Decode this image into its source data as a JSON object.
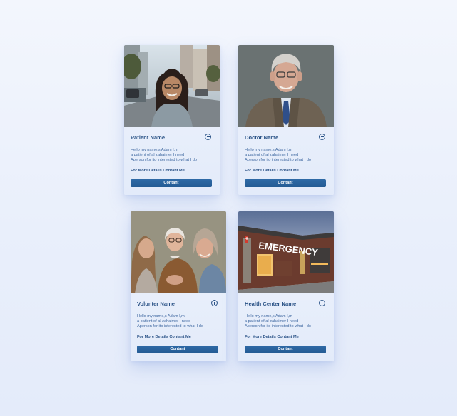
{
  "cards": [
    {
      "title": "Patient Name",
      "description": [
        "Hello my name,s Adam I,m",
        "a patient of al zahaimer I need",
        "Aperson for ito interested to what I do"
      ],
      "details": "For More Details Contant Me",
      "button": "Contant",
      "photo_icon": "woman-city-photo"
    },
    {
      "title": "Doctor Name",
      "description": [
        "Hello my name,s Adam I,m",
        "a patient of al zahaimer I need",
        "Aperson for ito interested to what I do"
      ],
      "details": "For More Details Contant Me",
      "button": "Contant",
      "photo_icon": "doctor-portrait-photo"
    },
    {
      "title": "Volunter Name",
      "description": [
        "Hello my name,s Adam I,m",
        "a patient of al zahaimer I need",
        "Aperson for ito interested to what I do"
      ],
      "details": "For More Details Contant Me",
      "button": "Contant",
      "photo_icon": "volunteers-group-photo"
    },
    {
      "title": "Health Center Name",
      "description": [
        "Hello my name,s Adam I,m",
        "a patient of al zahaimer I need",
        "Aperson for ito interested to what I do"
      ],
      "details": "For More Details Contant Me",
      "button": "Contant",
      "photo_icon": "emergency-building-photo",
      "sign_text": "EMERGENCY"
    }
  ],
  "colors": {
    "accent": "#2a5286",
    "button": "#245b94",
    "card_bg": "#eef3fc",
    "page_bg": "#eef2fc"
  }
}
